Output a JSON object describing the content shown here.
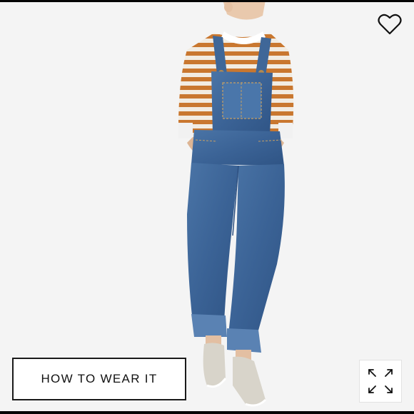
{
  "product_image": {
    "subject": "denim-overalls-model-photo",
    "background_color": "#f4f4f4",
    "denim_color": "#3f6798",
    "stripe_colors": [
      "#c9772f",
      "#f2ece2"
    ],
    "sneaker_color": "#d8d4ca"
  },
  "actions": {
    "favorite_icon": "heart-outline-icon",
    "how_to_wear_label": "HOW TO WEAR IT",
    "expand_icon": "expand-arrows-icon"
  }
}
